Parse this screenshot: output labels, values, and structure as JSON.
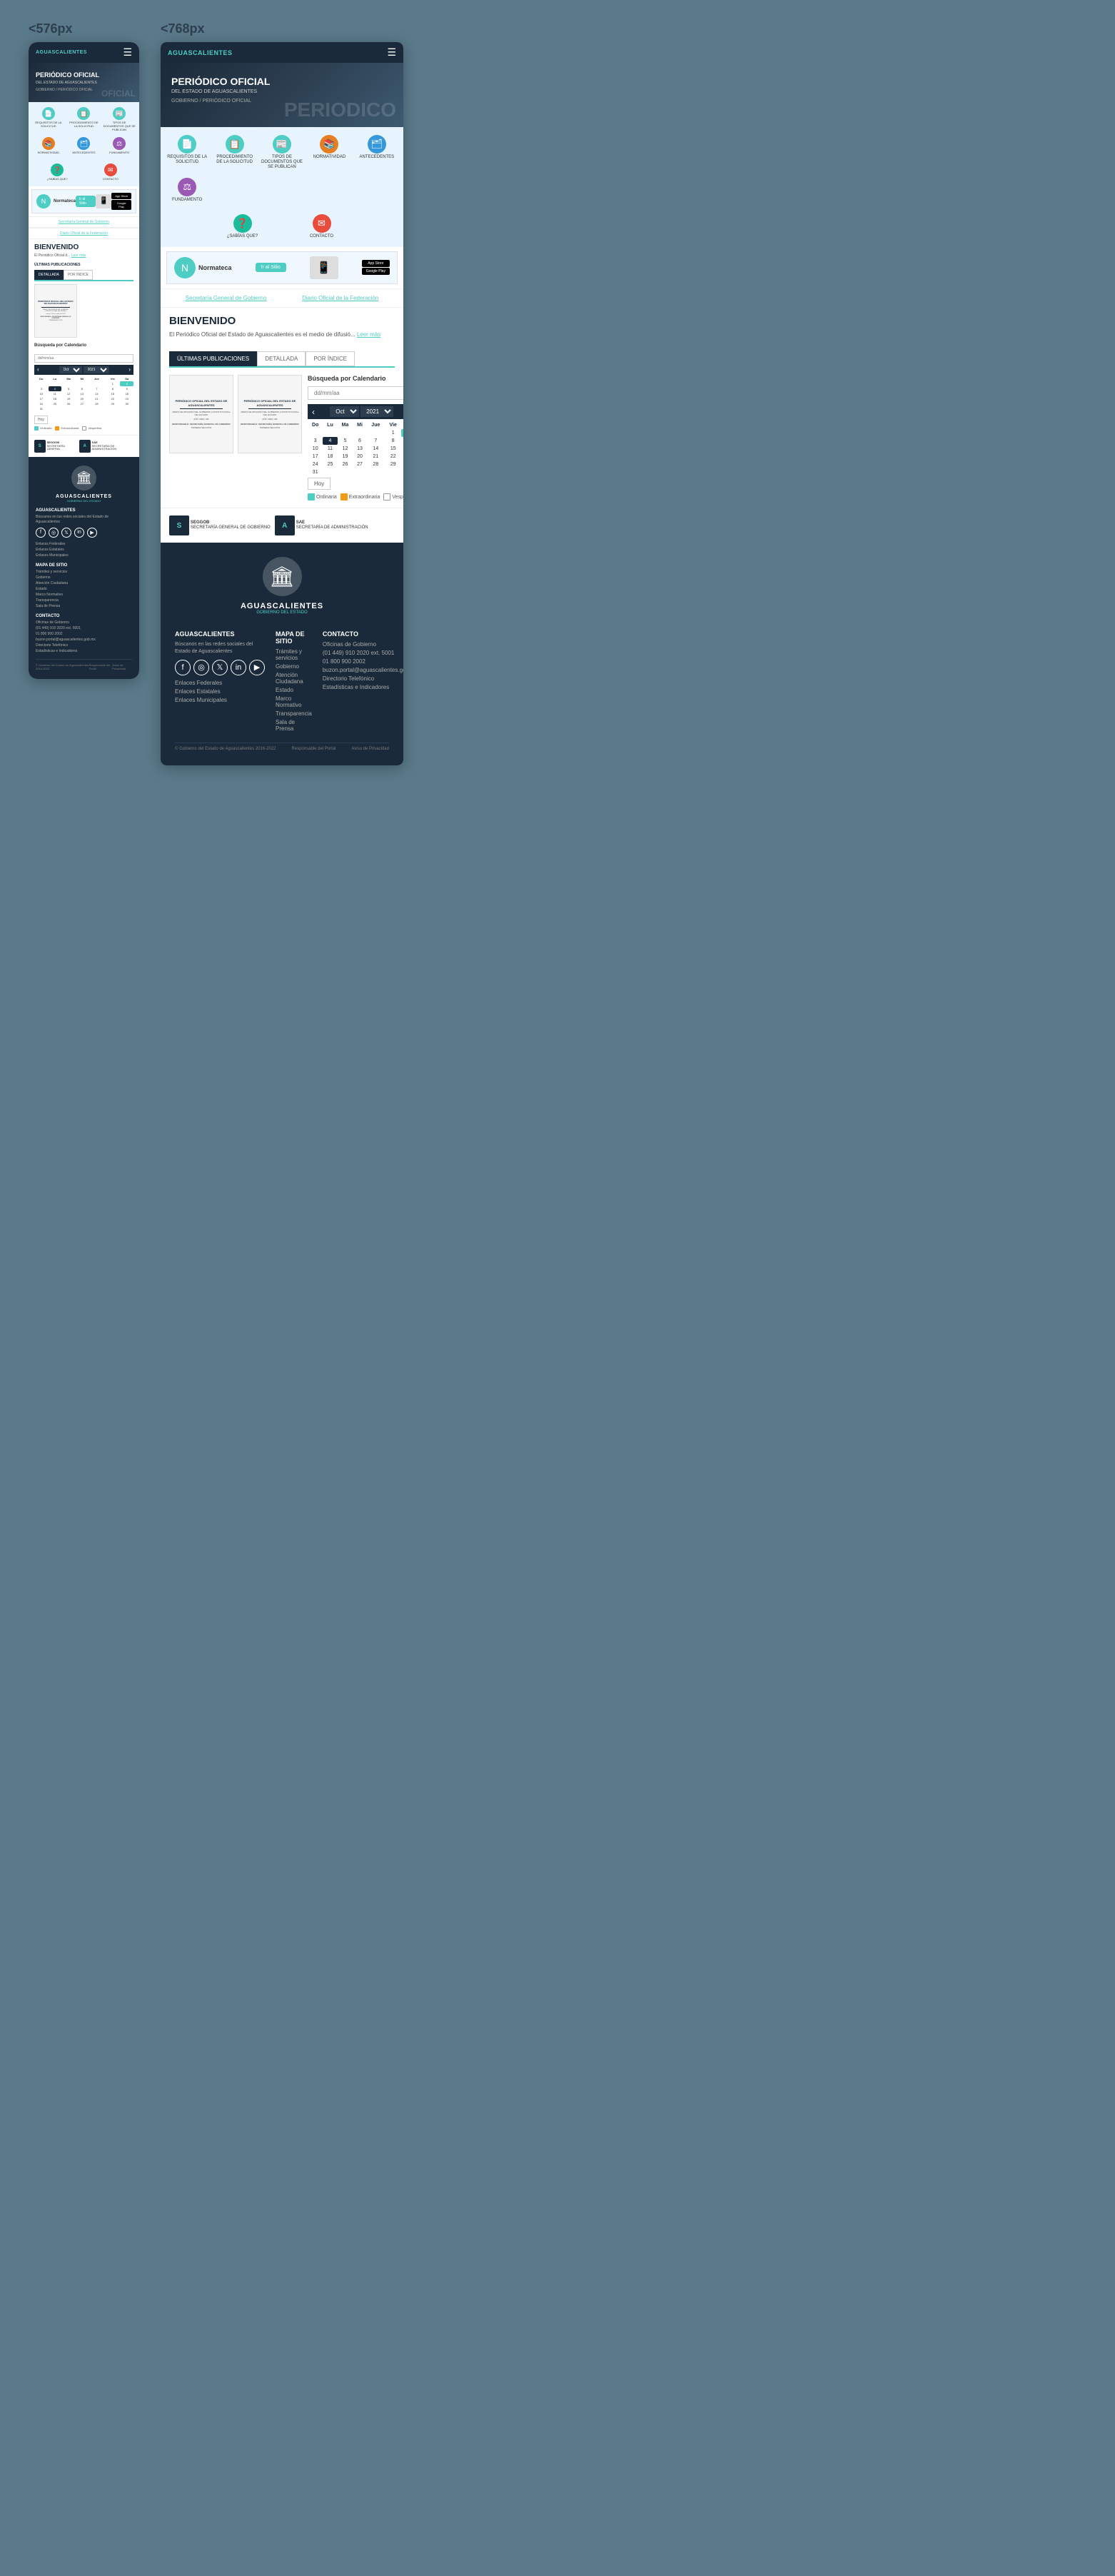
{
  "breakpoints": {
    "mobile": "<576px",
    "tablet": "<768px"
  },
  "header": {
    "logo": "AGUASCALIENTES",
    "menu_icon": "☰"
  },
  "hero": {
    "title": "PERIÓDICO OFICIAL",
    "subtitle": "DEL ESTADO DE AGUASCALIENTES",
    "breadcrumb": "GOBIERNO / PERIÓDICO OFICIAL",
    "deco": "PERIODICO"
  },
  "nav_icons": [
    {
      "icon": "📄",
      "label": "REQUISITOS DE LA SOLICITUD"
    },
    {
      "icon": "📋",
      "label": "PROCEDIMIENTO DE LA SOLICITUD"
    },
    {
      "icon": "📰",
      "label": "TIPOS DE DOCUMENTOS QUE SE PUBLICAN"
    },
    {
      "icon": "📚",
      "label": "NORMATIVIDAD"
    },
    {
      "icon": "🗂",
      "label": "ANTECEDENTES"
    },
    {
      "icon": "⚖",
      "label": "FUNDAMENTO"
    },
    {
      "icon": "❓",
      "label": "¿SABÍAS QUE?"
    },
    {
      "icon": "✉",
      "label": "CONTACTO"
    }
  ],
  "normateca": {
    "logo_text": "Normateca",
    "btn_label": "Ir al Sitio",
    "app_store": "App Store",
    "google_play": "Google Play"
  },
  "links": {
    "link1": "Secretaría General de Gobierno",
    "link2": "Diario Oficial de la Federación"
  },
  "bienvenido": {
    "title": "BIENVENIDO",
    "text": "El Periódico Oficial del Estado de Aguascalientes es el medio de difusió...",
    "text_mobile": "El Periódico Oficial d...",
    "read_more": "Leer más"
  },
  "tabs": {
    "ultimas": "ÚLTIMAS PUBLICACIONES",
    "detallada": "DETALLADA",
    "por_indice": "POR ÍNDICE"
  },
  "calendar": {
    "title": "Búsqueda por Calendario",
    "placeholder": "dd/mm/aa",
    "month": "Oct",
    "year": "2021",
    "days_header": [
      "Do",
      "Lu",
      "Ma",
      "Mi",
      "Jue",
      "Vie",
      "Sa"
    ],
    "weeks": [
      [
        "",
        "",
        "",
        "",
        "",
        "1",
        "2"
      ],
      [
        "3",
        "4",
        "5",
        "6",
        "7",
        "8",
        "9"
      ],
      [
        "10",
        "11",
        "12",
        "13",
        "14",
        "15",
        "16"
      ],
      [
        "17",
        "18",
        "19",
        "20",
        "21",
        "22",
        "23"
      ],
      [
        "24",
        "25",
        "26",
        "27",
        "28",
        "29",
        "30"
      ],
      [
        "31",
        "",
        "",
        "",
        "",
        "",
        ""
      ]
    ],
    "active_day": "4",
    "highlighted_day": "2",
    "today_label": "Hoy",
    "legend": {
      "ordinaria": "Ordinaria",
      "extraordinaria": "Extraordinaria",
      "vespertina": "Vespertina"
    }
  },
  "footer_logos": [
    {
      "name": "SEGGOB",
      "sub": "SECRETARIA GENERAL DE GOBIERNO"
    },
    {
      "name": "SAE",
      "sub": "SECRETARÍA DE ADMINISTRACIÓN"
    }
  ],
  "dark_footer": {
    "brand": "AGUASCALIENTES",
    "brand_sub": "GOBIERNO DEL ESTADO",
    "col1_title": "AGUASCALIENTES",
    "col1_desc": "Búscanos en las redes sociales del Estado de Aguascalientes",
    "social_icons": [
      "f",
      "◎",
      "🐦",
      "in",
      "▶"
    ],
    "col1_links": [
      "Enlaces Federales",
      "Enlaces Estatales",
      "Enlaces Municipales"
    ],
    "col2_title": "MAPA DE SITIO",
    "col2_links": [
      "Trámites y servicios",
      "Gobierno",
      "Atención Ciudadana",
      "Estado",
      "Marco Normativo",
      "Transparencia",
      "Sala de Prensa"
    ],
    "col3_title": "CONTACTO",
    "col3_links": [
      "Oficinas de Gobierno",
      "(01 449) 910 2020 ext. 5001",
      "01 800 900 2002",
      "buzon.portal@aguascalientes.gob.mx",
      "Directorio Telefónico",
      "Estadísticas e Indicadores"
    ],
    "bottom_left": "© Gobierno del Estado de Aguascalientes 2016-2022",
    "bottom_center": "Responsable del Portal",
    "bottom_right": "Aviso de Privacidad"
  }
}
